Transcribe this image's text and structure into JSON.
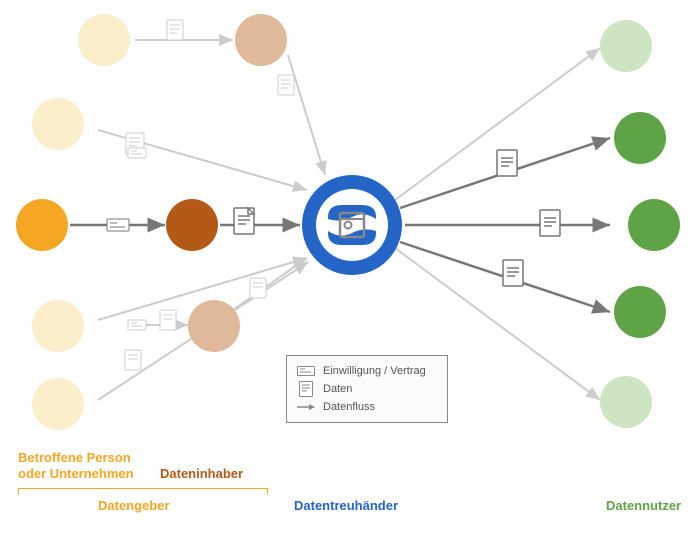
{
  "legend": {
    "consent": "Einwilligung / Vertrag",
    "data": "Daten",
    "flow": "Datenfluss"
  },
  "roles": {
    "affected": "Betroffene Person\noder Unternehmen",
    "owner": "Dateninhaber",
    "giver": "Datengeber",
    "trustee": "Datentreuhänder",
    "user": "Datennutzer"
  },
  "colors": {
    "yellow": "#f5a623",
    "paleYellow": "#fbeecb",
    "brown": "#b45a17",
    "paleBrown": "#e0b89a",
    "blue": "#2565c7",
    "green": "#5ea446",
    "paleGreen": "#cde5c3",
    "grey": "#888888",
    "lightGrey": "#cccccc"
  }
}
